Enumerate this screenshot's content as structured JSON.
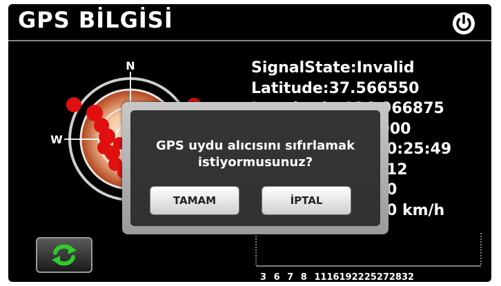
{
  "header": {
    "title": "GPS BİLGİSİ",
    "power_icon": "power-icon"
  },
  "gps_info": {
    "lines": [
      "SignalState:Invalid",
      "Latitude:37.566550",
      "Longitude:126.966875",
      "Altitude: 0.000000",
      "0:25:49",
      "12",
      "0",
      "0 km/h"
    ]
  },
  "radar": {
    "compass": [
      "N",
      "W"
    ]
  },
  "signal_chart": {
    "satellite_ids": [
      "3",
      "6",
      "7",
      "8",
      "11",
      "16",
      "19",
      "22",
      "25",
      "27",
      "28",
      "32"
    ]
  },
  "dialog": {
    "message_line1": "GPS uydu alıcısını sıfırlamak",
    "message_line2": "istiyormusunuz?",
    "ok_label": "TAMAM",
    "cancel_label": "İPTAL"
  },
  "refresh_icon": "refresh-icon",
  "colors": {
    "background": "#000000",
    "text": "#ffffff",
    "refresh_green": "#2ecc2e",
    "satellite_red": "#e01010"
  }
}
